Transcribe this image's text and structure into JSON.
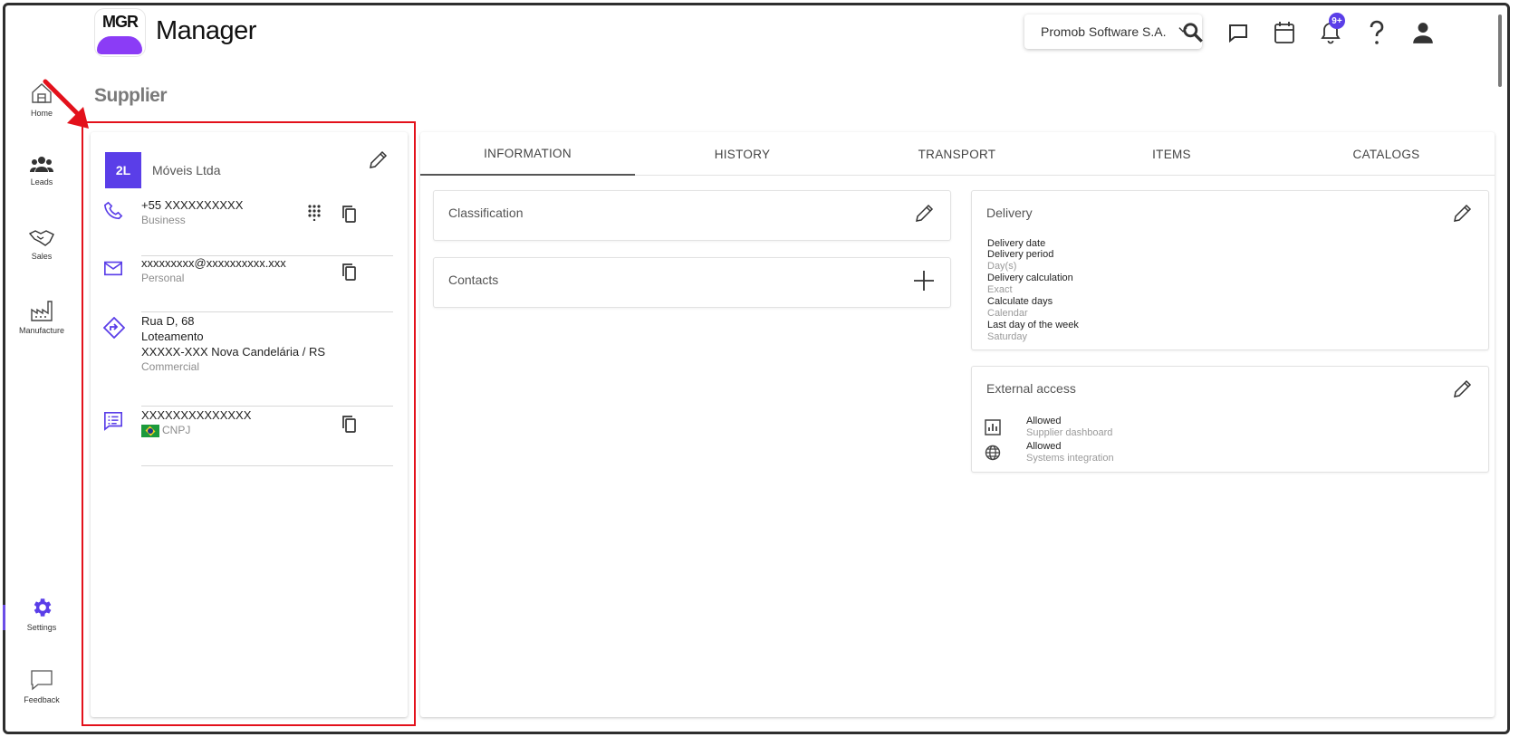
{
  "app": {
    "logo_text": "MGR",
    "name": "Manager"
  },
  "header": {
    "company_selector": "Promob Software S.A.",
    "notifications_badge": "9+"
  },
  "sidebar": {
    "items": [
      {
        "label": "Home",
        "icon": "home-icon"
      },
      {
        "label": "Leads",
        "icon": "people-icon"
      },
      {
        "label": "Sales",
        "icon": "handshake-icon"
      },
      {
        "label": "Manufacture",
        "icon": "factory-icon"
      },
      {
        "label": "Settings",
        "icon": "gear-icon",
        "active": true
      },
      {
        "label": "Feedback",
        "icon": "chat-icon"
      }
    ]
  },
  "page": {
    "title": "Supplier"
  },
  "supplier_card": {
    "avatar": "2L",
    "name": "Móveis Ltda",
    "phone": {
      "value": "+55 XXXXXXXXXX",
      "type": "Business"
    },
    "email": {
      "value": "xxxxxxxxx@xxxxxxxxxx.xxx",
      "type": "Personal"
    },
    "address": {
      "line1": "Rua D, 68",
      "line2": "Loteamento",
      "line3": "XXXXX-XXX Nova Candelária / RS",
      "type": "Commercial"
    },
    "document": {
      "value": "XXXXXXXXXXXXXX",
      "type": "CNPJ"
    }
  },
  "tabs": [
    "INFORMATION",
    "HISTORY",
    "TRANSPORT",
    "ITEMS",
    "CATALOGS"
  ],
  "classification": {
    "title": "Classification"
  },
  "contacts": {
    "title": "Contacts"
  },
  "delivery": {
    "title": "Delivery",
    "fields": [
      {
        "label": "Delivery date",
        "value": ""
      },
      {
        "label": "Delivery period",
        "value": "Day(s)"
      },
      {
        "label": "Delivery calculation",
        "value": "Exact"
      },
      {
        "label": "Calculate days",
        "value": "Calendar"
      },
      {
        "label": "Last day of the week",
        "value": "Saturday"
      }
    ]
  },
  "external_access": {
    "title": "External access",
    "rows": [
      {
        "status": "Allowed",
        "label": "Supplier dashboard",
        "icon": "chart-icon"
      },
      {
        "status": "Allowed",
        "label": "Systems integration",
        "icon": "globe-icon"
      }
    ]
  },
  "colors": {
    "accent": "#5a3ee8",
    "highlight": "#e3111b"
  }
}
